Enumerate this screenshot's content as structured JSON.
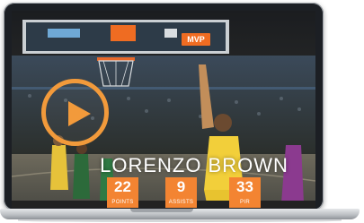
{
  "player": {
    "name": "LORENZO BROWN"
  },
  "badge": {
    "label": "MVP"
  },
  "stats": [
    {
      "value": "22",
      "label": "POINTS"
    },
    {
      "value": "9",
      "label": "ASSISTS"
    },
    {
      "value": "33",
      "label": "PIR"
    }
  ],
  "video": {
    "play_icon": "play-icon"
  },
  "colors": {
    "accent": "#f38432",
    "ring": "#f29a3b"
  }
}
